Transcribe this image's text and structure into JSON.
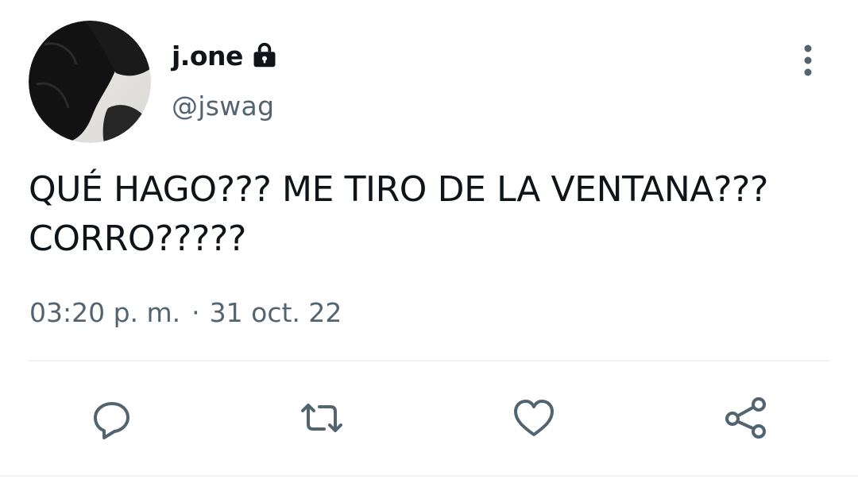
{
  "user": {
    "display_name": "j.one",
    "handle": "@jswag",
    "protected": true
  },
  "tweet": {
    "text": "QUÉ HAGO??? ME TIRO DE LA VENTANA??? CORRO?????",
    "time": "03:20 p. m.",
    "separator": "·",
    "date": "31 oct. 22"
  },
  "actions": [
    "reply-icon",
    "retweet-icon",
    "like-icon",
    "share-icon"
  ],
  "colors": {
    "text_primary": "#0f1419",
    "text_secondary": "#536471",
    "divider": "#eff3f4"
  }
}
